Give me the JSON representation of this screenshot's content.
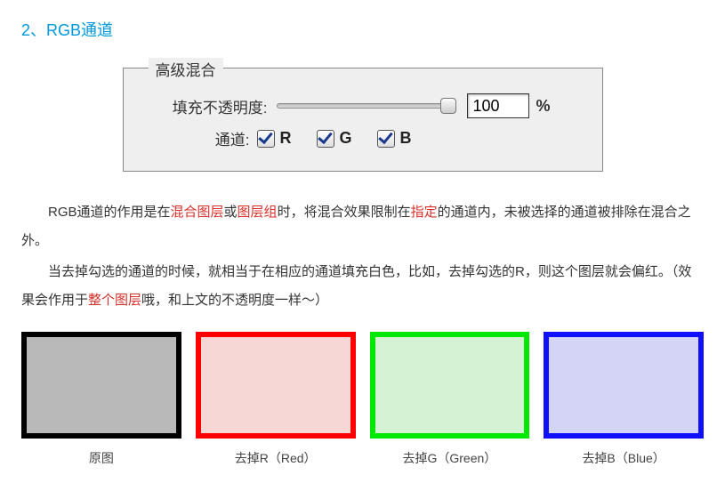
{
  "section_title": "2、RGB通道",
  "panel": {
    "legend": "高级混合",
    "fill_label": "填充不透明度:",
    "fill_value": "100",
    "percent": "%",
    "channel_label": "通道:",
    "channels": {
      "r": "R",
      "g": "G",
      "b": "B"
    }
  },
  "para1": {
    "t1": "RGB通道的作用是在",
    "r1": "混合图层",
    "t2": "或",
    "r2": "图层组",
    "t3": "时，将混合效果限制在",
    "r3": "指定",
    "t4": "的通道内，未被选择的通道被排除在混合之外。"
  },
  "para2": {
    "t1": "当去掉勾选的通道的时候，就相当于在相应的通道填充白色，比如，去掉勾选的R，则这个图层就会偏红。（效果会作用于",
    "r1": "整个图层",
    "t2": "哦，和上文的不透明度一样～）"
  },
  "swatches": [
    {
      "label": "原图"
    },
    {
      "label": "去掉R（Red）"
    },
    {
      "label": "去掉G（Green）"
    },
    {
      "label": "去掉B（Blue）"
    }
  ]
}
